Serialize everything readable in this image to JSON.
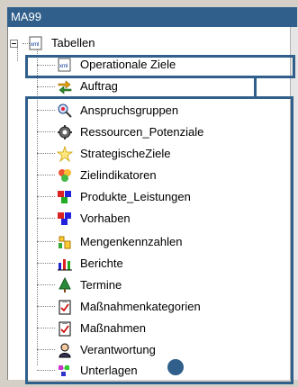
{
  "window": {
    "title": "MA99"
  },
  "tree": {
    "root": {
      "label": "Tabellen",
      "icon": "xml-file-icon"
    },
    "children": [
      {
        "label": "Operationale Ziele",
        "icon": "xml-file-icon"
      },
      {
        "label": "Auftrag",
        "icon": "exchange-arrows-icon"
      }
    ],
    "items": [
      {
        "label": "Anspruchsgruppen",
        "icon": "stakeholder-search-icon"
      },
      {
        "label": "Ressourcen_Potenziale",
        "icon": "gear-icon"
      },
      {
        "label": "StrategischeZiele",
        "icon": "star-icon"
      },
      {
        "label": "Zielindikatoren",
        "icon": "colored-dots-icon"
      },
      {
        "label": "Produkte_Leistungen",
        "icon": "product-cubes-icon"
      },
      {
        "label": "Vorhaben",
        "icon": "project-cubes-icon"
      },
      {
        "label": "Mengenkennzahlen",
        "icon": "quantity-chart-icon"
      },
      {
        "label": "Berichte",
        "icon": "bar-chart-icon"
      },
      {
        "label": "Termine",
        "icon": "tree-icon"
      },
      {
        "label": "Maßnahmenkategorien",
        "icon": "checklist-icon"
      },
      {
        "label": "Maßnahmen",
        "icon": "checklist-icon"
      },
      {
        "label": "Verantwortung",
        "icon": "person-icon"
      },
      {
        "label": "Unterlagen",
        "icon": "documents-icon"
      }
    ]
  },
  "colors": {
    "accent": "#2f5f8a",
    "background": "#d4d0c8"
  }
}
